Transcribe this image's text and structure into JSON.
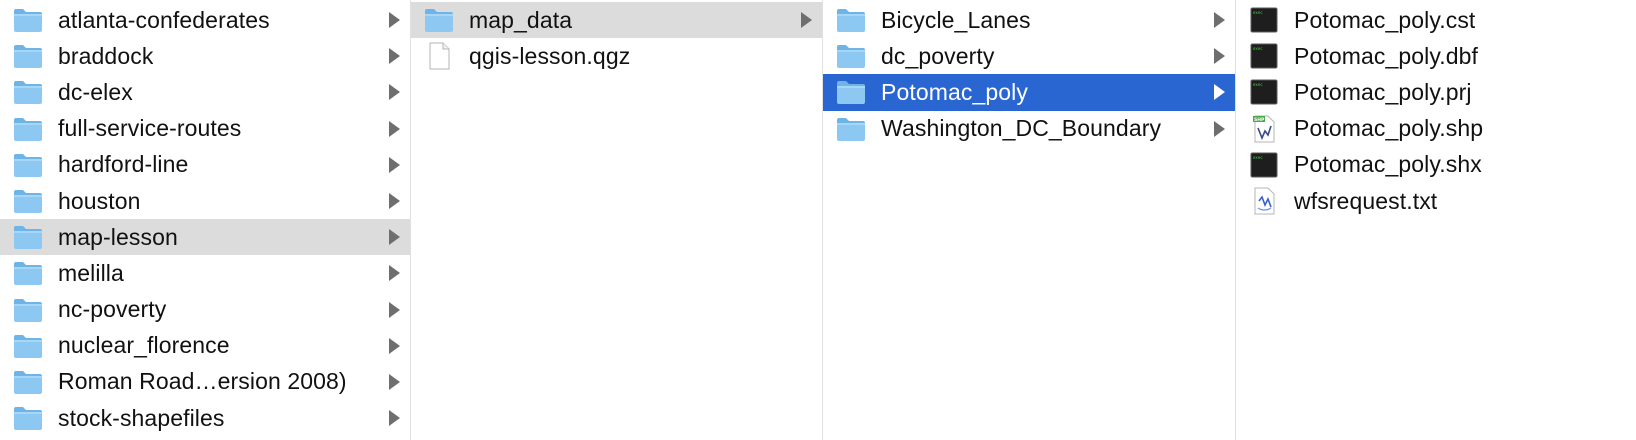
{
  "columns": [
    {
      "items": [
        {
          "label": "atlanta-confederates",
          "icon": "folder-icon",
          "expandable": true,
          "state": "none"
        },
        {
          "label": "braddock",
          "icon": "folder-icon",
          "expandable": true,
          "state": "none"
        },
        {
          "label": "dc-elex",
          "icon": "folder-icon",
          "expandable": true,
          "state": "none"
        },
        {
          "label": "full-service-routes",
          "icon": "folder-icon",
          "expandable": true,
          "state": "none"
        },
        {
          "label": "hardford-line",
          "icon": "folder-icon",
          "expandable": true,
          "state": "none"
        },
        {
          "label": "houston",
          "icon": "folder-icon",
          "expandable": true,
          "state": "none"
        },
        {
          "label": "map-lesson",
          "icon": "folder-icon",
          "expandable": true,
          "state": "selected-inactive"
        },
        {
          "label": "melilla",
          "icon": "folder-icon",
          "expandable": true,
          "state": "none"
        },
        {
          "label": "nc-poverty",
          "icon": "folder-icon",
          "expandable": true,
          "state": "none"
        },
        {
          "label": "nuclear_florence",
          "icon": "folder-icon",
          "expandable": true,
          "state": "none"
        },
        {
          "label": "Roman Road…ersion 2008)",
          "icon": "folder-icon",
          "expandable": true,
          "state": "none"
        },
        {
          "label": "stock-shapefiles",
          "icon": "folder-icon",
          "expandable": true,
          "state": "none"
        }
      ]
    },
    {
      "items": [
        {
          "label": "map_data",
          "icon": "folder-icon",
          "expandable": true,
          "state": "selected-inactive"
        },
        {
          "label": "qgis-lesson.qgz",
          "icon": "blank-document-icon",
          "expandable": false,
          "state": "none"
        }
      ]
    },
    {
      "items": [
        {
          "label": "Bicycle_Lanes",
          "icon": "folder-icon",
          "expandable": true,
          "state": "none"
        },
        {
          "label": "dc_poverty",
          "icon": "folder-icon",
          "expandable": true,
          "state": "none"
        },
        {
          "label": "Potomac_poly",
          "icon": "folder-icon",
          "expandable": true,
          "state": "selected-active"
        },
        {
          "label": "Washington_DC_Boundary",
          "icon": "folder-icon",
          "expandable": true,
          "state": "none"
        }
      ]
    },
    {
      "items": [
        {
          "label": "Potomac_poly.cst",
          "icon": "terminal-file-icon",
          "expandable": false,
          "state": "none"
        },
        {
          "label": "Potomac_poly.dbf",
          "icon": "terminal-file-icon",
          "expandable": false,
          "state": "none"
        },
        {
          "label": "Potomac_poly.prj",
          "icon": "terminal-file-icon",
          "expandable": false,
          "state": "none"
        },
        {
          "label": "Potomac_poly.shp",
          "icon": "shp-file-icon",
          "expandable": false,
          "state": "none"
        },
        {
          "label": "Potomac_poly.shx",
          "icon": "terminal-file-icon",
          "expandable": false,
          "state": "none"
        },
        {
          "label": "wfsrequest.txt",
          "icon": "text-file-icon",
          "expandable": false,
          "state": "none"
        }
      ]
    }
  ],
  "colors": {
    "folder": "#8cc8f2",
    "folder_tab": "#6fb4e6",
    "selected_active": "#2a66d2",
    "selected_inactive": "#dcdcdc",
    "disclosure": "#6e6e6e"
  }
}
